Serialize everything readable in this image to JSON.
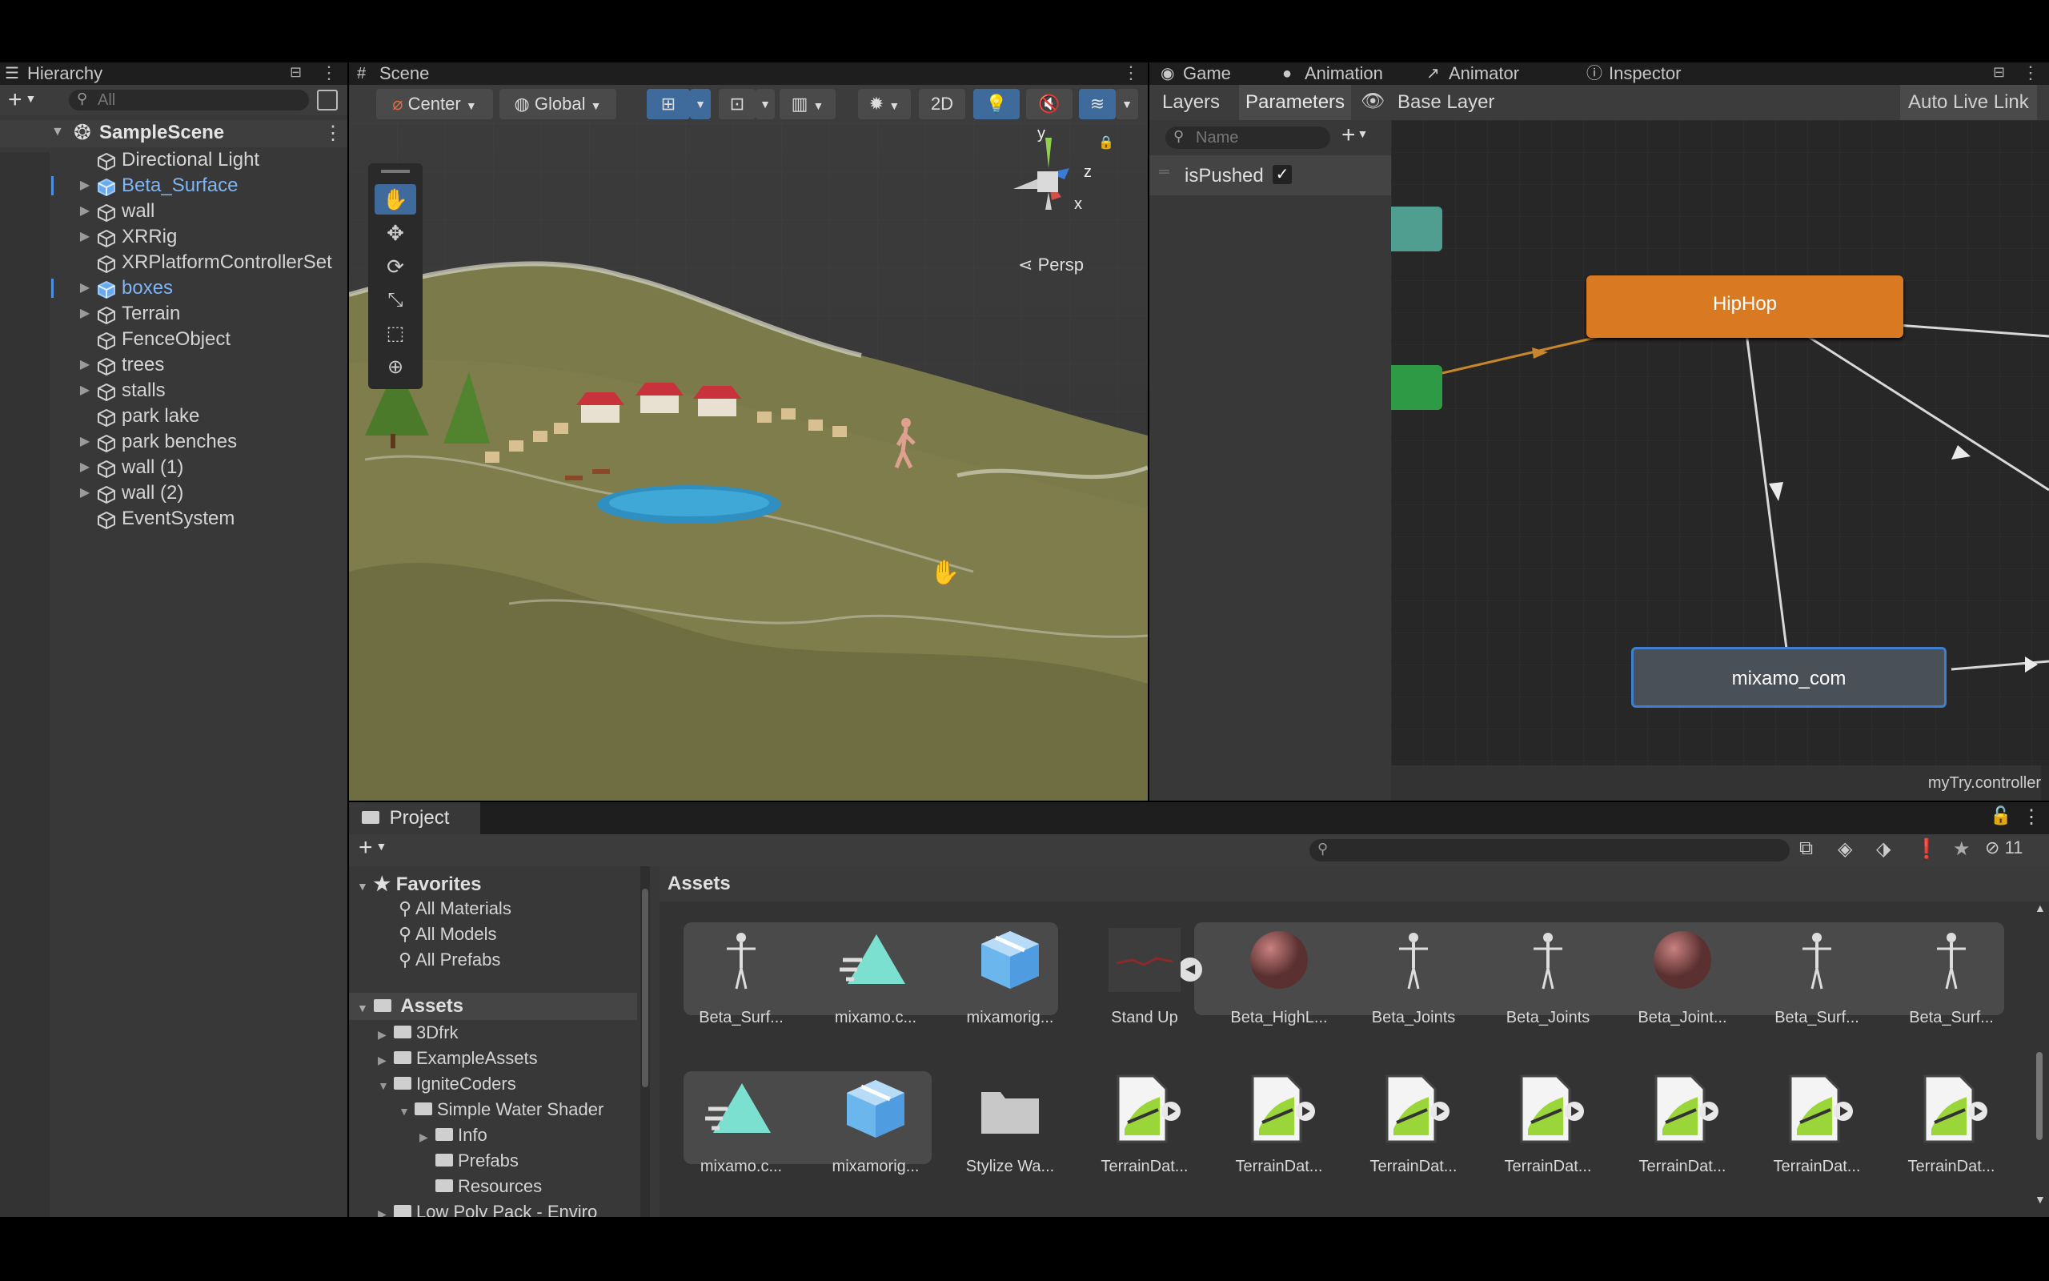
{
  "hierarchy": {
    "tab_label": "Hierarchy",
    "search_placeholder": "All",
    "scene_name": "SampleScene",
    "items": [
      {
        "label": "Directional Light",
        "expandable": false,
        "highlight": false
      },
      {
        "label": "Beta_Surface",
        "expandable": true,
        "highlight": true
      },
      {
        "label": "wall",
        "expandable": true,
        "highlight": false
      },
      {
        "label": "XRRig",
        "expandable": true,
        "highlight": false
      },
      {
        "label": "XRPlatformControllerSet",
        "expandable": false,
        "highlight": false
      },
      {
        "label": "boxes",
        "expandable": true,
        "highlight": true
      },
      {
        "label": "Terrain",
        "expandable": true,
        "highlight": false
      },
      {
        "label": "FenceObject",
        "expandable": false,
        "highlight": false
      },
      {
        "label": "trees",
        "expandable": true,
        "highlight": false
      },
      {
        "label": "stalls",
        "expandable": true,
        "highlight": false
      },
      {
        "label": "park lake",
        "expandable": false,
        "highlight": false
      },
      {
        "label": "park benches",
        "expandable": true,
        "highlight": false
      },
      {
        "label": "wall (1)",
        "expandable": true,
        "highlight": false
      },
      {
        "label": "wall (2)",
        "expandable": true,
        "highlight": false
      },
      {
        "label": "EventSystem",
        "expandable": false,
        "highlight": false
      }
    ]
  },
  "scene": {
    "tab_label": "Scene",
    "pivot_label": "Center",
    "space_label": "Global",
    "mode_2d_label": "2D",
    "gizmo_y": "y",
    "gizmo_z": "z",
    "gizmo_x": "x",
    "persp_label": "Persp"
  },
  "top_tabs": {
    "game": "Game",
    "animation": "Animation",
    "animator": "Animator",
    "inspector": "Inspector"
  },
  "animator": {
    "layers_label": "Layers",
    "parameters_label": "Parameters",
    "base_layer_label": "Base Layer",
    "auto_live_link_label": "Auto Live Link",
    "search_placeholder": "Name",
    "param_name": "isPushed",
    "param_checked": true,
    "node_hiphop": "HipHop",
    "node_mixamo": "mixamo_com",
    "controller_file": "myTry.controller",
    "colors": {
      "hiphop": "#d97a22",
      "mixamo": "#4a5058",
      "teal": "#4f9e90",
      "green": "#2f9a45"
    }
  },
  "project": {
    "tab_label": "Project",
    "hidden_count": "11",
    "favorites_label": "Favorites",
    "favorites": [
      "All Materials",
      "All Models",
      "All Prefabs"
    ],
    "assets_root": "Assets",
    "folders": [
      {
        "label": "3Dfrk",
        "indent": 1,
        "arrow": "▶"
      },
      {
        "label": "ExampleAssets",
        "indent": 1,
        "arrow": "▶"
      },
      {
        "label": "IgniteCoders",
        "indent": 1,
        "arrow": "▼"
      },
      {
        "label": "Simple Water Shader",
        "indent": 2,
        "arrow": "▼"
      },
      {
        "label": "Info",
        "indent": 3,
        "arrow": "▶"
      },
      {
        "label": "Prefabs",
        "indent": 3,
        "arrow": ""
      },
      {
        "label": "Resources",
        "indent": 3,
        "arrow": ""
      },
      {
        "label": "Low Poly Pack - Enviro",
        "indent": 1,
        "arrow": "▶"
      }
    ],
    "grid_header": "Assets",
    "row1": [
      {
        "label": "Beta_Surf...",
        "icon": "figure-icon"
      },
      {
        "label": "mixamo.c...",
        "icon": "animation-clip-icon"
      },
      {
        "label": "mixamorig...",
        "icon": "prefab-icon"
      },
      {
        "label": "Stand Up",
        "icon": "model-thumbnail"
      },
      {
        "label": "Beta_HighL...",
        "icon": "material-sphere-icon"
      },
      {
        "label": "Beta_Joints",
        "icon": "figure-icon"
      },
      {
        "label": "Beta_Joints",
        "icon": "figure-icon"
      },
      {
        "label": "Beta_Joint...",
        "icon": "material-sphere-icon"
      },
      {
        "label": "Beta_Surf...",
        "icon": "figure-icon"
      },
      {
        "label": "Beta_Surf...",
        "icon": "figure-icon"
      }
    ],
    "row2": [
      {
        "label": "mixamo.c...",
        "icon": "animation-clip-icon"
      },
      {
        "label": "mixamorig...",
        "icon": "prefab-icon"
      },
      {
        "label": "Stylize Wa...",
        "icon": "folder-icon"
      },
      {
        "label": "TerrainDat...",
        "icon": "terrain-data-icon"
      },
      {
        "label": "TerrainDat...",
        "icon": "terrain-data-icon"
      },
      {
        "label": "TerrainDat...",
        "icon": "terrain-data-icon"
      },
      {
        "label": "TerrainDat...",
        "icon": "terrain-data-icon"
      },
      {
        "label": "TerrainDat...",
        "icon": "terrain-data-icon"
      },
      {
        "label": "TerrainDat...",
        "icon": "terrain-data-icon"
      },
      {
        "label": "TerrainDat...",
        "icon": "terrain-data-icon"
      }
    ]
  }
}
